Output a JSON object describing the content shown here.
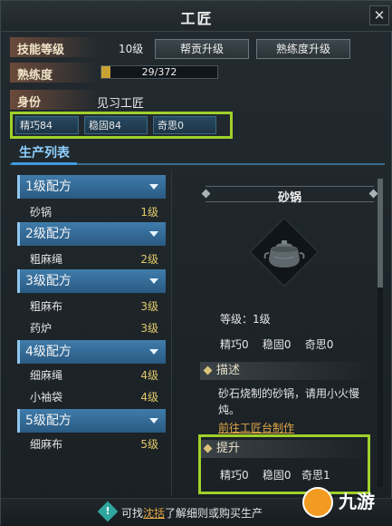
{
  "window": {
    "title": "工匠",
    "close_glyph": "✕"
  },
  "stats": {
    "skill_level": {
      "label": "技能等级",
      "value": "10级"
    },
    "buttons": {
      "gang_upgrade": "帮贡升级",
      "proficiency_upgrade": "熟练度升级"
    },
    "proficiency": {
      "label": "熟练度",
      "text": "29/372",
      "progress_fraction": 0.078
    },
    "identity": {
      "label": "身份",
      "value": "见习工匠"
    },
    "attributes": [
      "精巧84",
      "稳固84",
      "奇思0"
    ]
  },
  "tabs": [
    {
      "label": "生产列表"
    }
  ],
  "production_list": {
    "categories": [
      {
        "label": "1级配方",
        "items": [
          {
            "name": "砂锅",
            "level": "1级"
          }
        ]
      },
      {
        "label": "2级配方",
        "items": [
          {
            "name": "粗麻绳",
            "level": "2级"
          }
        ]
      },
      {
        "label": "3级配方",
        "items": [
          {
            "name": "粗麻布",
            "level": "3级"
          },
          {
            "name": "药炉",
            "level": "3级"
          }
        ]
      },
      {
        "label": "4级配方",
        "items": [
          {
            "name": "细麻绳",
            "level": "4级"
          },
          {
            "name": "小袖袋",
            "level": "4级"
          }
        ]
      },
      {
        "label": "5级配方",
        "items": [
          {
            "name": "细麻布",
            "level": "5级"
          }
        ]
      }
    ]
  },
  "detail": {
    "name": "砂锅",
    "icon": "clay-pot-icon",
    "level_line": "等级：1级",
    "stats_line": "精巧0    稳固0    奇思0",
    "description_title": "描述",
    "description": "砂石烧制的砂锅，请用小火慢炖。",
    "workbench_link": "前往工匠台制作",
    "upgrade_title": "提升",
    "upgrade_line": "精巧0    稳固0   奇思1"
  },
  "footer": {
    "prefix": "可找",
    "link": "沈括",
    "suffix": "了解细则或购买生产",
    "icon": "exclamation-icon"
  },
  "watermark": {
    "text": "九游"
  },
  "colors": {
    "highlight": "#9fd02a",
    "tab_accent": "#3f9ae0",
    "category_bg": "#3f7cab",
    "level_text": "#e0c96a",
    "link": "#e2a84a"
  }
}
